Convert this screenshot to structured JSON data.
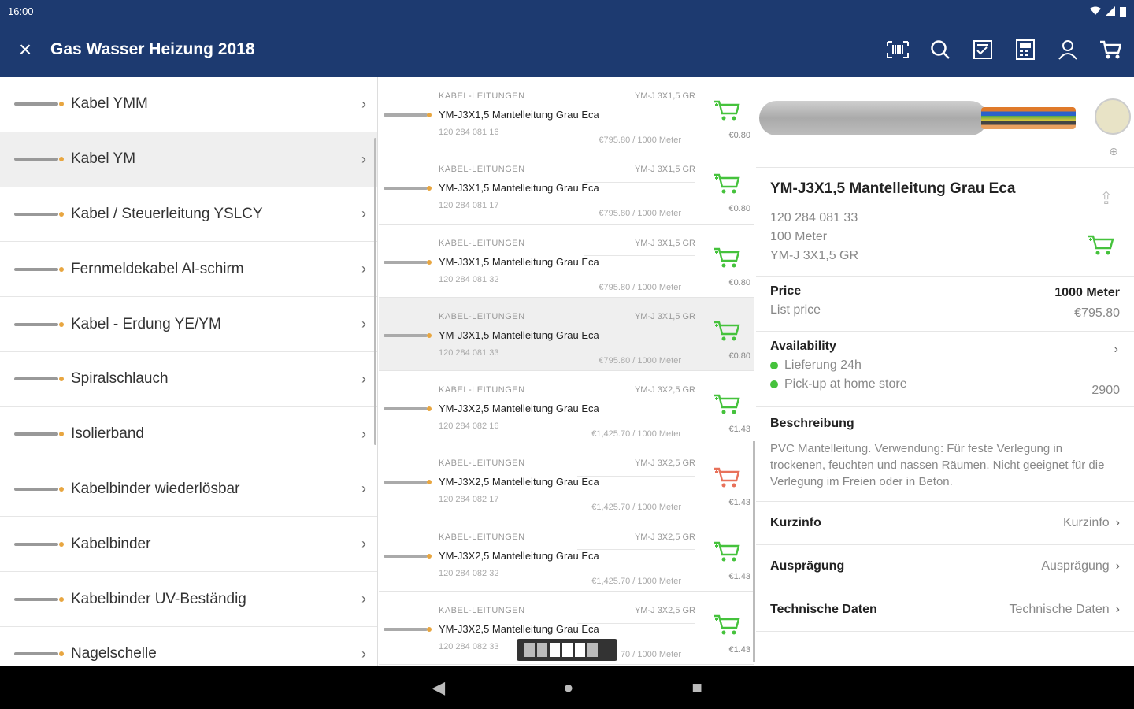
{
  "status": {
    "time": "16:00"
  },
  "appbar": {
    "close_icon": "×",
    "title": "Gas Wasser Heizung 2018",
    "actions": [
      "barcode-scan-icon",
      "search-icon",
      "checklist-icon",
      "calculator-icon",
      "user-icon",
      "cart-icon"
    ]
  },
  "categories": [
    {
      "label": "Kabel YMM"
    },
    {
      "label": "Kabel YM"
    },
    {
      "label": "Kabel / Steuerleitung YSLCY"
    },
    {
      "label": "Fernmeldekabel Al-schirm"
    },
    {
      "label": "Kabel - Erdung YE/YM"
    },
    {
      "label": "Spiralschlauch"
    },
    {
      "label": "Isolierband"
    },
    {
      "label": "Kabelbinder wiederlösbar"
    },
    {
      "label": "Kabelbinder"
    },
    {
      "label": "Kabelbinder UV-Beständig"
    },
    {
      "label": "Nagelschelle"
    }
  ],
  "products": [
    {
      "cat": "KABEL-LEITUNGEN",
      "code": "YM-J 3X1,5 GR",
      "name": "YM-J3X1,5 Mantelleitung Grau Eca",
      "num": "120 284 081 16",
      "price": "€795.80 / 1000 Meter",
      "unit": "€0.80",
      "cart_color": "#45c23c"
    },
    {
      "cat": "KABEL-LEITUNGEN",
      "code": "YM-J 3X1,5 GR",
      "name": "YM-J3X1,5 Mantelleitung Grau Eca",
      "num": "120 284 081 17",
      "price": "€795.80 / 1000 Meter",
      "unit": "€0.80",
      "cart_color": "#45c23c"
    },
    {
      "cat": "KABEL-LEITUNGEN",
      "code": "YM-J 3X1,5 GR",
      "name": "YM-J3X1,5 Mantelleitung Grau Eca",
      "num": "120 284 081 32",
      "price": "€795.80 / 1000 Meter",
      "unit": "€0.80",
      "cart_color": "#45c23c"
    },
    {
      "cat": "KABEL-LEITUNGEN",
      "code": "YM-J 3X1,5 GR",
      "name": "YM-J3X1,5 Mantelleitung Grau Eca",
      "num": "120 284 081 33",
      "price": "€795.80 / 1000 Meter",
      "unit": "€0.80",
      "cart_color": "#45c23c"
    },
    {
      "cat": "KABEL-LEITUNGEN",
      "code": "YM-J 3X2,5 GR",
      "name": "YM-J3X2,5 Mantelleitung Grau Eca",
      "num": "120 284 082 16",
      "price": "€1,425.70 / 1000 Meter",
      "unit": "€1.43",
      "cart_color": "#45c23c"
    },
    {
      "cat": "KABEL-LEITUNGEN",
      "code": "YM-J 3X2,5 GR",
      "name": "YM-J3X2,5 Mantelleitung Grau Eca",
      "num": "120 284 082 17",
      "price": "€1,425.70 / 1000 Meter",
      "unit": "€1.43",
      "cart_color": "#e8715a"
    },
    {
      "cat": "KABEL-LEITUNGEN",
      "code": "YM-J 3X2,5 GR",
      "name": "YM-J3X2,5 Mantelleitung Grau Eca",
      "num": "120 284 082 32",
      "price": "€1,425.70 / 1000 Meter",
      "unit": "€1.43",
      "cart_color": "#45c23c"
    },
    {
      "cat": "KABEL-LEITUNGEN",
      "code": "YM-J 3X2,5 GR",
      "name": "YM-J3X2,5 Mantelleitung Grau Eca",
      "num": "120 284 082 33",
      "price": "70 / 1000 Meter",
      "unit": "€1.43",
      "cart_color": "#45c23c"
    }
  ],
  "detail": {
    "title": "YM-J3X1,5 Mantelleitung Grau Eca",
    "num": "120 284 081 33",
    "qty": "100 Meter",
    "code": "YM-J 3X1,5 GR",
    "price_label": "Price",
    "price_unit": "1000 Meter",
    "list_label": "List price",
    "list_value": "€795.80",
    "availability": "Availability",
    "delivery": "Lieferung 24h",
    "pickup": "Pick-up at home store",
    "pickup_qty": "2900",
    "desc_title": "Beschreibung",
    "desc_text": "PVC Mantelleitung. Verwendung: Für feste Verlegung in trockenen, feuchten und nassen Räumen. Nicht geeignet für die Verlegung im Freien oder in Beton.",
    "rows": [
      {
        "k": "Kurzinfo",
        "v": "Kurzinfo"
      },
      {
        "k": "Ausprägung",
        "v": "Ausprägung"
      },
      {
        "k": "Technische Daten",
        "v": "Technische Daten"
      }
    ]
  }
}
